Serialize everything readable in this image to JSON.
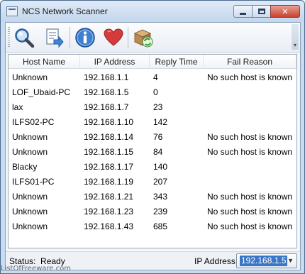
{
  "window": {
    "title": "NCS Network Scanner",
    "controls": {
      "minimize": "",
      "maximize": "",
      "close": "✕"
    }
  },
  "toolbar": {
    "buttons": [
      {
        "name": "scan",
        "icon": "magnifier-icon"
      },
      {
        "name": "export",
        "icon": "export-document-icon"
      },
      {
        "name": "about",
        "icon": "info-icon"
      },
      {
        "name": "favorite",
        "icon": "heart-icon"
      },
      {
        "name": "update",
        "icon": "package-refresh-icon"
      }
    ]
  },
  "table": {
    "columns": [
      "Host Name",
      "IP Address",
      "Reply Time",
      "Fail Reason"
    ],
    "rows": [
      [
        "Unknown",
        "192.168.1.1",
        "4",
        "No such host is known"
      ],
      [
        "LOF_Ubaid-PC",
        "192.168.1.5",
        "0",
        ""
      ],
      [
        "lax",
        "192.168.1.7",
        "23",
        ""
      ],
      [
        "ILFS02-PC",
        "192.168.1.10",
        "142",
        ""
      ],
      [
        "Unknown",
        "192.168.1.14",
        "76",
        "No such host is known"
      ],
      [
        "Unknown",
        "192.168.1.15",
        "84",
        "No such host is known"
      ],
      [
        "Blacky",
        "192.168.1.17",
        "140",
        ""
      ],
      [
        "ILFS01-PC",
        "192.168.1.19",
        "207",
        ""
      ],
      [
        "Unknown",
        "192.168.1.21",
        "343",
        "No such host is known"
      ],
      [
        "Unknown",
        "192.168.1.23",
        "239",
        "No such host is known"
      ],
      [
        "Unknown",
        "192.168.1.43",
        "685",
        "No such host is known"
      ]
    ]
  },
  "status": {
    "label": "Status:",
    "value": "Ready",
    "ip_label": "IP Address:",
    "ip_selected": "192.168.1.5"
  },
  "watermark": "ListOfFreeware.com",
  "colors": {
    "title_bar": "#c9dbef",
    "close_button": "#c8412e",
    "selection": "#3a76c6"
  }
}
